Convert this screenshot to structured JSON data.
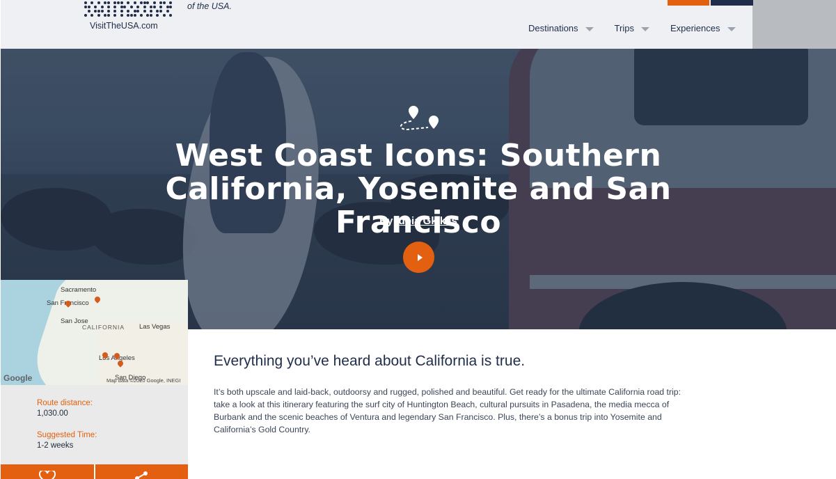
{
  "header": {
    "logo_text": "VisitTheUSA.com",
    "tagline": "of the USA.",
    "nav": [
      {
        "label": "Destinations"
      },
      {
        "label": "Trips"
      },
      {
        "label": "Experiences"
      }
    ]
  },
  "hero": {
    "title": "West Coast Icons: Southern California, Yosemite and San Francisco",
    "byline_prefix": "By",
    "author": "Idoia Gkikas",
    "play_icon": "play-icon",
    "route_icon": "route-icon"
  },
  "map": {
    "labels": {
      "sacramento": "Sacramento",
      "san_francisco": "San Francisco",
      "san_jose": "San Jose",
      "california": "CALIFORNIA",
      "las_vegas": "Las Vegas",
      "los_angeles": "Los Angeles",
      "san_diego": "San Diego"
    },
    "logo": "Google",
    "attribution": "Map data ©2020 Google, INEGI",
    "pin_color": "#d55a1b"
  },
  "info": {
    "route_distance_label": "Route distance:",
    "route_distance_value": "1,030.00",
    "suggested_time_label": "Suggested Time:",
    "suggested_time_value": "1-2 weeks"
  },
  "actions": {
    "favorite_icon": "heart-icon",
    "share_icon": "share-icon"
  },
  "article": {
    "heading": "Everything you’ve heard about California is true.",
    "body": "It’s both upscale and laid-back, outdoorsy and rugged, polished and beautiful. Get ready for the ultimate California road trip: take a look at this itinerary featuring the surf city of Huntington Beach, cultural pursuits in Pasadena, the media mecca of Burbank and the scenic beaches of Ventura and legendary San Francisco. Plus, there’s a bonus trip into Yosemite and California’s Gold Country."
  },
  "colors": {
    "accent": "#e2600f",
    "navy": "#1f2d4a",
    "header_bg": "#eef0f3",
    "info_bg": "#eaeaea"
  }
}
